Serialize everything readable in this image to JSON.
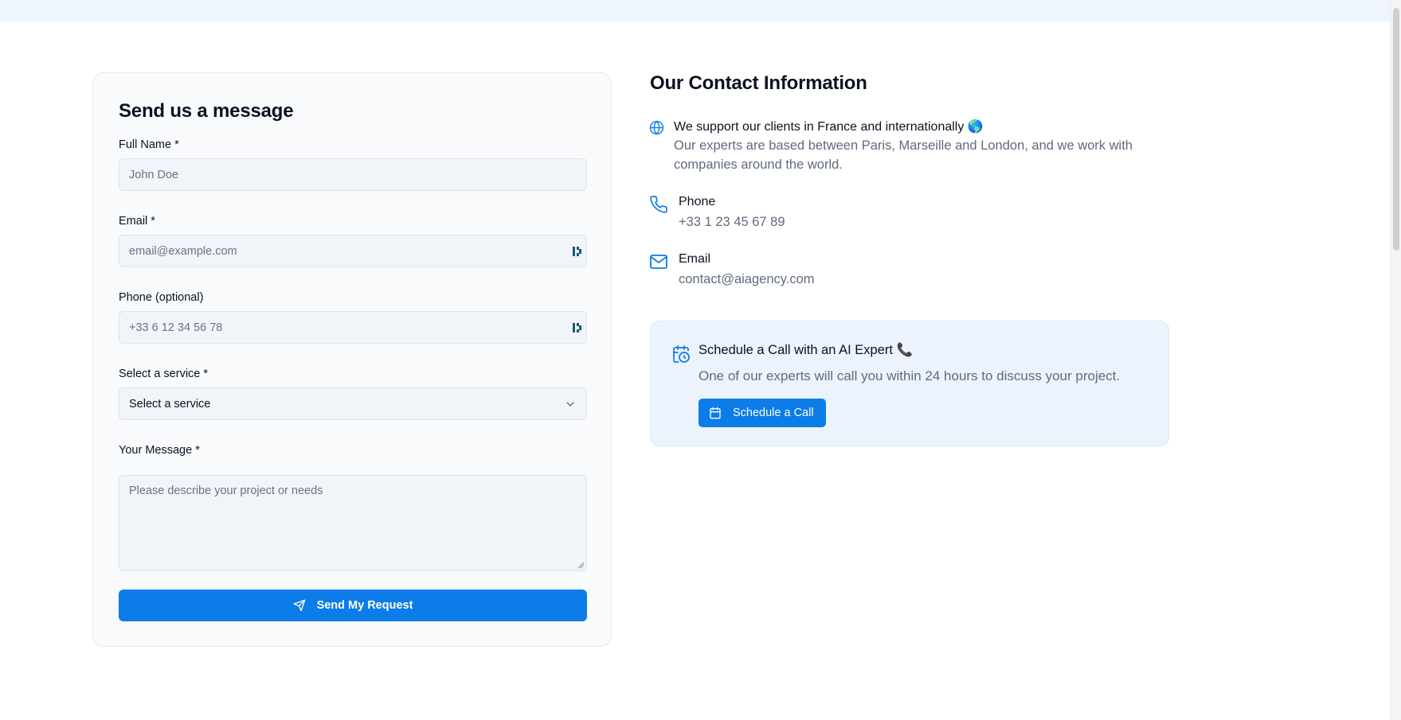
{
  "form": {
    "title": "Send us a message",
    "fields": [
      {
        "label": "Full Name *",
        "placeholder": "John Doe"
      },
      {
        "label": "Email *",
        "placeholder": "email@example.com"
      },
      {
        "label": "Phone (optional)",
        "placeholder": "+33 6 12 34 56 78"
      }
    ],
    "service": {
      "label": "Select a service *",
      "value": "Select a service"
    },
    "message": {
      "label": "Your Message *",
      "placeholder": "Please describe your project or needs"
    },
    "submit_label": "Send My Request"
  },
  "contact": {
    "title": "Our Contact Information",
    "support": {
      "heading": "We support our clients in France and internationally 🌎",
      "text": "Our experts are based between Paris, Marseille and London, and we work with companies around the world."
    },
    "phone": {
      "heading": "Phone",
      "value": "+33 1 23 45 67 89"
    },
    "email": {
      "heading": "Email",
      "value": "contact@aiagency.com"
    }
  },
  "schedule": {
    "title": "Schedule a Call with an AI Expert 📞",
    "text": "One of our experts will call you within 24 hours to discuss your project.",
    "button_label": "Schedule a Call"
  },
  "colors": {
    "accent": "#0b7ce8",
    "muted_text": "#5f6b7d",
    "card_bg": "#f8fafc",
    "schedule_bg": "#ecf3fd"
  },
  "icons": {
    "support": "globe-icon",
    "phone": "phone-icon",
    "email": "mail-icon",
    "schedule": "calendar-clock-icon",
    "schedule_button": "calendar-icon",
    "submit": "send-icon",
    "select": "chevron-down-icon"
  }
}
